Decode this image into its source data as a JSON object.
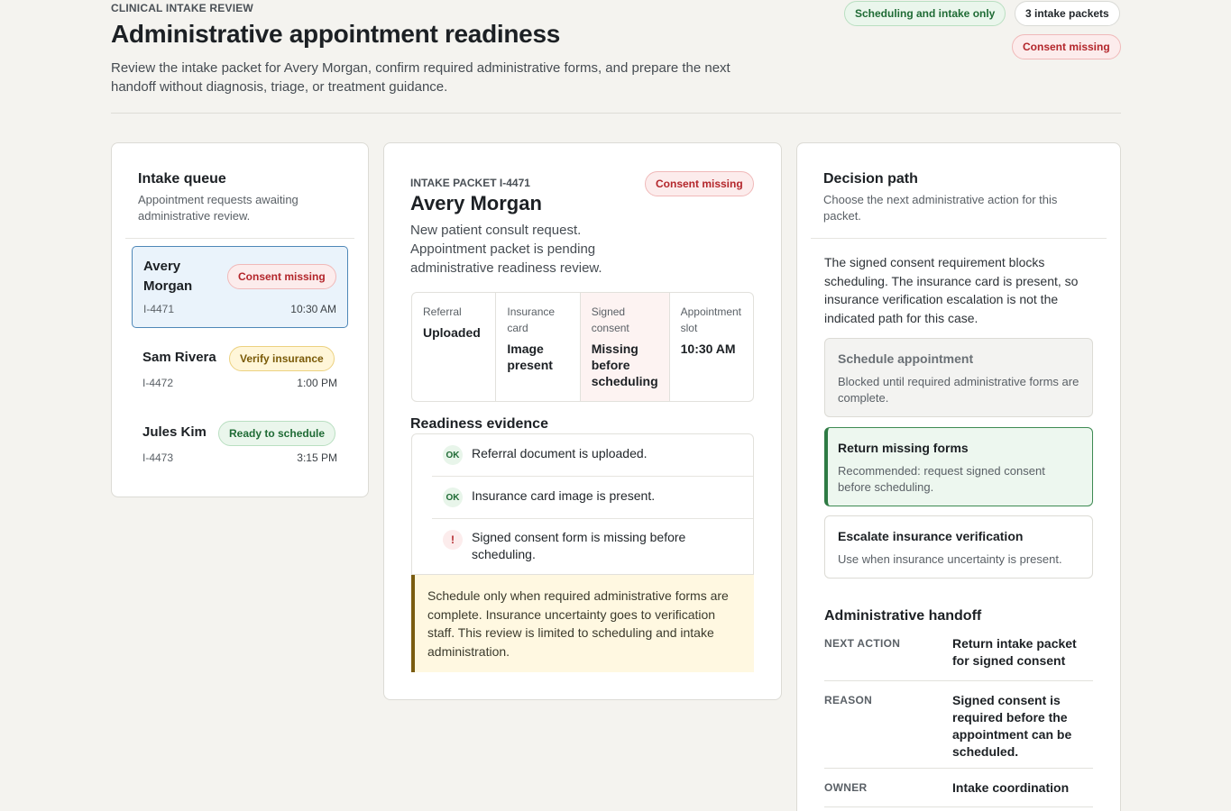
{
  "header": {
    "eyebrow": "CLINICAL INTAKE REVIEW",
    "title": "Administrative appointment readiness",
    "subtitle": "Review the intake packet for Avery Morgan, confirm required administrative forms, and prepare the next handoff without diagnosis, triage, or treatment guidance.",
    "badges": {
      "scope": "Scheduling and intake only",
      "count": "3 intake packets",
      "status": "Consent missing"
    }
  },
  "queue": {
    "title": "Intake queue",
    "subtitle": "Appointment requests awaiting administrative review.",
    "items": [
      {
        "name": "Avery Morgan",
        "status": "Consent missing",
        "id": "I-4471",
        "time": "10:30 AM"
      },
      {
        "name": "Sam Rivera",
        "status": "Verify insurance",
        "id": "I-4472",
        "time": "1:00 PM"
      },
      {
        "name": "Jules Kim",
        "status": "Ready to schedule",
        "id": "I-4473",
        "time": "3:15 PM"
      }
    ]
  },
  "packet": {
    "eyebrow": "INTAKE PACKET I-4471",
    "name": "Avery Morgan",
    "status": "Consent missing",
    "description": "New patient consult request. Appointment packet is pending administrative readiness review.",
    "fields": [
      {
        "label": "Referral",
        "value": "Uploaded"
      },
      {
        "label": "Insurance card",
        "value": "Image present"
      },
      {
        "label": "Signed consent",
        "value": "Missing before scheduling"
      },
      {
        "label": "Appointment slot",
        "value": "10:30 AM"
      }
    ],
    "evidence_title": "Readiness evidence",
    "evidence": [
      {
        "icon": "OK",
        "text": "Referral document is uploaded."
      },
      {
        "icon": "OK",
        "text": "Insurance card image is present."
      },
      {
        "icon": "!",
        "text": "Signed consent form is missing before scheduling."
      }
    ],
    "note": "Schedule only when required administrative forms are complete. Insurance uncertainty goes to verification staff. This review is limited to scheduling and intake administration."
  },
  "decision": {
    "title": "Decision path",
    "subtitle": "Choose the next administrative action for this packet.",
    "intro": "The signed consent requirement blocks scheduling. The insurance card is present, so insurance verification escalation is not the indicated path for this case.",
    "options": [
      {
        "title": "Schedule appointment",
        "description": "Blocked until required administrative forms are complete."
      },
      {
        "title": "Return missing forms",
        "description": "Recommended: request signed consent before scheduling."
      },
      {
        "title": "Escalate insurance verification",
        "description": "Use when insurance uncertainty is present."
      }
    ],
    "handoff_title": "Administrative handoff",
    "handoff": [
      {
        "key": "NEXT ACTION",
        "value": "Return intake packet for signed consent"
      },
      {
        "key": "REASON",
        "value": "Signed consent is required before the appointment can be scheduled."
      },
      {
        "key": "OWNER",
        "value": "Intake coordination"
      }
    ]
  },
  "colors": {
    "background": "#f4f3ef",
    "success": "#1f6b35",
    "danger": "#b3262b",
    "warning": "#7a5a08",
    "selected": "#4e87b7"
  }
}
